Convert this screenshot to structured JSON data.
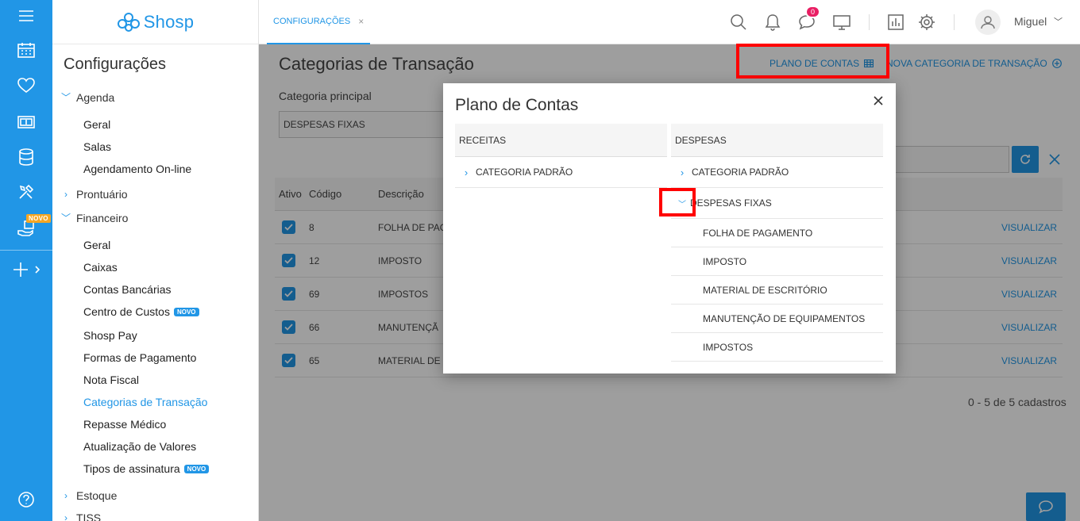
{
  "app": {
    "brand": "Shosp"
  },
  "rail": {
    "novo_badge": "NOVO"
  },
  "sidebar": {
    "title": "Configurações",
    "sections": {
      "agenda": "Agenda",
      "prontuario": "Prontuário",
      "financeiro": "Financeiro",
      "estoque": "Estoque",
      "tiss": "TISS"
    },
    "agenda_items": [
      "Geral",
      "Salas",
      "Agendamento On-line"
    ],
    "financeiro_items": [
      "Geral",
      "Caixas",
      "Contas Bancárias",
      "Centro de Custos",
      "Shosp Pay",
      "Formas de Pagamento",
      "Nota Fiscal",
      "Categorias de Transação",
      "Repasse Médico",
      "Atualização de Valores",
      "Tipos de assinatura"
    ],
    "novo_label": "NOVO"
  },
  "topbar": {
    "tab_label": "CONFIGURAÇÕES",
    "tab_close": "×",
    "notif_count": "0",
    "user_name": "Miguel"
  },
  "main": {
    "page_title": "Categorias de Transação",
    "plano_link": "PLANO DE CONTAS",
    "nova_link": "NOVA CATEGORIA DE TRANSAÇÃO",
    "field_label": "Categoria principal",
    "select_value": "DESPESAS FIXAS",
    "table": {
      "headers": [
        "Ativo",
        "Código",
        "Descrição"
      ],
      "rows": [
        {
          "codigo": "8",
          "descricao": "FOLHA DE PAG"
        },
        {
          "codigo": "12",
          "descricao": "IMPOSTO"
        },
        {
          "codigo": "69",
          "descricao": "IMPOSTOS"
        },
        {
          "codigo": "66",
          "descricao": "MANUTENÇÃ"
        },
        {
          "codigo": "65",
          "descricao": "MATERIAL DE"
        }
      ],
      "action_label": "VISUALIZAR"
    },
    "pager": "0 - 5 de 5 cadastros"
  },
  "modal": {
    "title": "Plano de Contas",
    "receitas": {
      "header": "RECEITAS",
      "items": [
        "CATEGORIA PADRÃO"
      ]
    },
    "despesas": {
      "header": "DESPESAS",
      "items": [
        "CATEGORIA PADRÃO",
        "DESPESAS FIXAS"
      ],
      "children": [
        "FOLHA DE PAGAMENTO",
        "IMPOSTO",
        "MATERIAL DE ESCRITÓRIO",
        "MANUTENÇÃO DE EQUIPAMENTOS",
        "IMPOSTOS"
      ]
    }
  },
  "colors": {
    "accent": "#2196e6",
    "highlight": "#ff0000",
    "notification": "#e91e63",
    "badge_orange": "#f5a623"
  }
}
